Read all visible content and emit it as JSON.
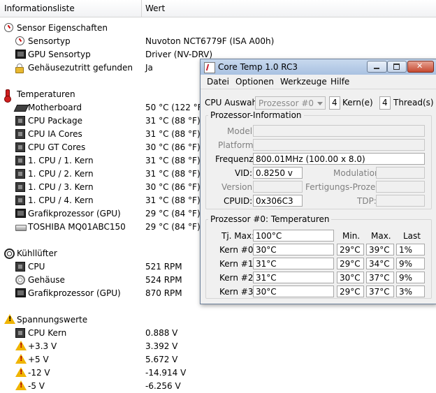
{
  "list": {
    "col_item": "Informationsliste",
    "col_value": "Wert",
    "rows": [
      {
        "label": "Sensor Eigenschaften",
        "value": "",
        "icon": "sensor-gauge-icon",
        "level": 0
      },
      {
        "label": "Sensortyp",
        "value": "Nuvoton NCT6779F  (ISA A00h)",
        "icon": "sensor-gauge-icon",
        "level": 1
      },
      {
        "label": "GPU Sensortyp",
        "value": "Driver  (NV-DRV)",
        "icon": "gpu-chip-icon",
        "level": 1
      },
      {
        "label": "Gehäusezutritt gefunden",
        "value": "Ja",
        "icon": "lock-icon",
        "level": 1
      },
      {
        "label": "Temperaturen",
        "value": "",
        "icon": "thermometer-icon",
        "level": 0
      },
      {
        "label": "Motherboard",
        "value": "50 °C  (122 °F)",
        "icon": "motherboard-icon",
        "level": 1
      },
      {
        "label": "CPU Package",
        "value": "31 °C  (88 °F)",
        "icon": "cpu-chip-icon",
        "level": 1
      },
      {
        "label": "CPU IA Cores",
        "value": "31 °C  (88 °F)",
        "icon": "cpu-chip-icon",
        "level": 1
      },
      {
        "label": "CPU GT Cores",
        "value": "30 °C  (86 °F)",
        "icon": "cpu-chip-icon",
        "level": 1
      },
      {
        "label": "1. CPU / 1. Kern",
        "value": "31 °C  (88 °F)",
        "icon": "cpu-chip-icon",
        "level": 1
      },
      {
        "label": "1. CPU / 2. Kern",
        "value": "31 °C  (88 °F)",
        "icon": "cpu-chip-icon",
        "level": 1
      },
      {
        "label": "1. CPU / 3. Kern",
        "value": "30 °C  (86 °F)",
        "icon": "cpu-chip-icon",
        "level": 1
      },
      {
        "label": "1. CPU / 4. Kern",
        "value": "31 °C  (88 °F)",
        "icon": "cpu-chip-icon",
        "level": 1
      },
      {
        "label": "Grafikprozessor (GPU)",
        "value": "29 °C  (84 °F)",
        "icon": "gpu-chip-icon",
        "level": 1
      },
      {
        "label": "TOSHIBA MQ01ABC150",
        "value": "29 °C  (84 °F)",
        "icon": "hard-disk-icon",
        "level": 1
      },
      {
        "label": "Kühllüfter",
        "value": "",
        "icon": "fan-icon",
        "level": 0
      },
      {
        "label": "CPU",
        "value": "521 RPM",
        "icon": "cpu-chip-icon",
        "level": 1
      },
      {
        "label": "Gehäuse",
        "value": "524 RPM",
        "icon": "case-fan-icon",
        "level": 1
      },
      {
        "label": "Grafikprozessor (GPU)",
        "value": "870 RPM",
        "icon": "gpu-chip-icon",
        "level": 1
      },
      {
        "label": "Spannungswerte",
        "value": "",
        "icon": "warning-icon",
        "level": 0
      },
      {
        "label": "CPU Kern",
        "value": "0.888 V",
        "icon": "cpu-chip-icon",
        "level": 1
      },
      {
        "label": "+3.3 V",
        "value": "3.392 V",
        "icon": "voltage-warning-icon",
        "level": 1
      },
      {
        "label": "+5 V",
        "value": "5.672 V",
        "icon": "voltage-warning-icon",
        "level": 1
      },
      {
        "label": "-12 V",
        "value": "-14.914 V",
        "icon": "voltage-warning-icon",
        "level": 1
      },
      {
        "label": "-5 V",
        "value": "-6.256 V",
        "icon": "voltage-warning-icon",
        "level": 1
      }
    ]
  },
  "coretemp": {
    "title": "Core Temp 1.0 RC3",
    "menu": [
      "Datei",
      "Optionen",
      "Werkzeuge",
      "Hilfe"
    ],
    "cpu_select_label": "CPU Auswahl:",
    "cpu_select_value": "Prozessor #0",
    "cores_count": "4",
    "cores_label": "Kern(e)",
    "threads_count": "4",
    "threads_label": "Thread(s)",
    "info_group": "Prozessor-Information",
    "model_label": "Model:",
    "model_value": "",
    "platform_label": "Platform:",
    "platform_value": "",
    "freq_label": "Frequenz:",
    "freq_value": "800.01MHz (100.00 x 8.0)",
    "vid_label": "VID:",
    "vid_value": "0.8250 v",
    "modulation_label": "Modulation:",
    "modulation_value": "",
    "version_label": "Version:",
    "version_value": "",
    "process_label": "Fertigungs-Prozess:",
    "process_value": "",
    "cpuid_label": "CPUID:",
    "cpuid_value": "0x306C3",
    "tdp_label": "TDP:",
    "tdp_value": "",
    "temp_group": "Prozessor #0: Temperaturen",
    "tjmax_label": "Tj. Max:",
    "tjmax_value": "100°C",
    "col_min": "Min.",
    "col_max": "Max.",
    "col_last": "Last",
    "cores": [
      {
        "label": "Kern #0:",
        "temp": "30°C",
        "min": "29°C",
        "max": "39°C",
        "load": "1%"
      },
      {
        "label": "Kern #1:",
        "temp": "31°C",
        "min": "29°C",
        "max": "34°C",
        "load": "9%"
      },
      {
        "label": "Kern #2:",
        "temp": "31°C",
        "min": "30°C",
        "max": "37°C",
        "load": "9%"
      },
      {
        "label": "Kern #3:",
        "temp": "30°C",
        "min": "29°C",
        "max": "37°C",
        "load": "3%"
      }
    ]
  }
}
